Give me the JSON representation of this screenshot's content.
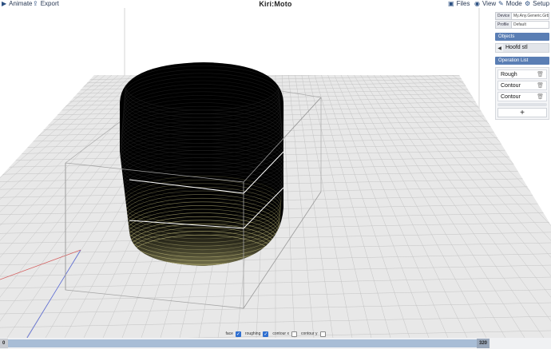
{
  "topbar": {
    "brand": "Kiri:Moto",
    "animate_label": "Animate",
    "export_label": "Export",
    "files_label": "Files",
    "view_label": "View",
    "mode_label": "Mode",
    "setup_label": "Setup"
  },
  "panel": {
    "device_key": "Device",
    "device_value": "My.Any.Generic.Grbl",
    "profile_key": "Profile",
    "profile_value": "Default",
    "objects_header": "Objects",
    "object_name": "Hoofd stl",
    "ops_header": "Operation List",
    "operations": [
      {
        "label": "Rough"
      },
      {
        "label": "Contour"
      },
      {
        "label": "Contour"
      }
    ],
    "add_label": "+"
  },
  "toggles": [
    {
      "label": "face",
      "checked": true
    },
    {
      "label": "roughing",
      "checked": true
    },
    {
      "label": "contour x",
      "checked": false
    },
    {
      "label": "contour y",
      "checked": false
    }
  ],
  "slider": {
    "min": "0",
    "max": "320"
  },
  "viewport": {
    "bed_color": "#e8e8e8",
    "grid_color": "#c3c3c3",
    "toolpath_color": "#000000",
    "toolpath_highlight": "#d8d28a"
  }
}
